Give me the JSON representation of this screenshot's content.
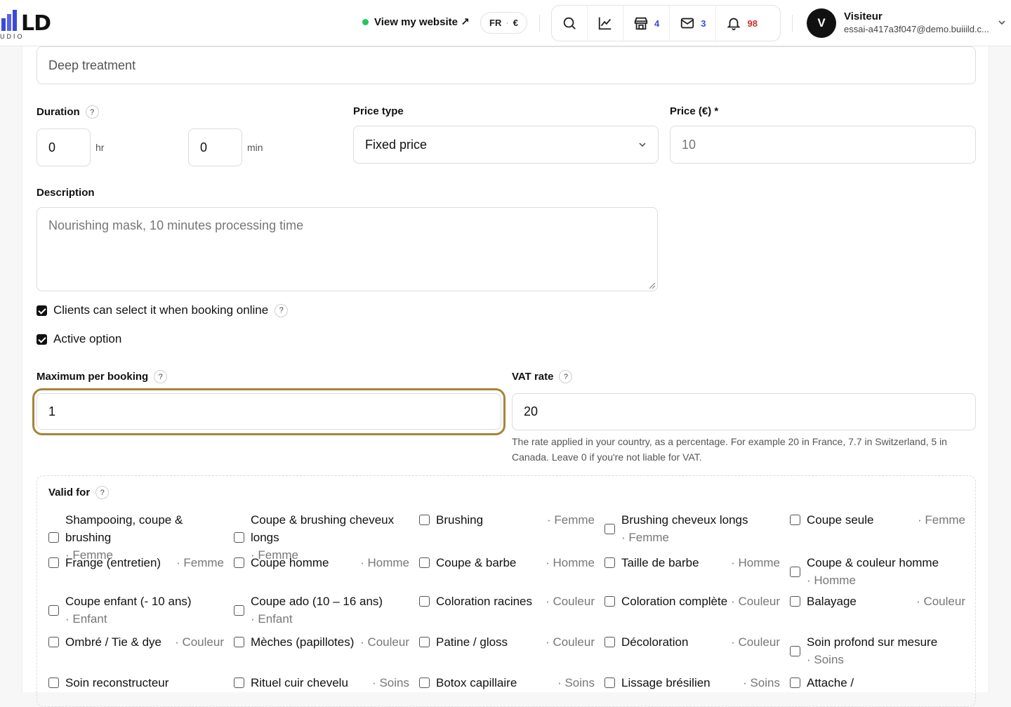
{
  "header": {
    "logo_text": "LD",
    "logo_sub": "UDIO",
    "view_site": "View my website ↗",
    "lang": "FR",
    "currency": "€",
    "counts": {
      "shop": "4",
      "mail": "3",
      "bell": "98"
    },
    "user": {
      "initial": "V",
      "name": "Visiteur",
      "email": "essai-a417a3f047@demo.buiiild.c..."
    },
    "colors": {
      "accent_blue": "#3b4ad6",
      "alert_red": "#d02c2c",
      "online_green": "#22c55e",
      "focus": "#a8833a"
    }
  },
  "form": {
    "name_value": "Deep treatment",
    "duration": {
      "label": "Duration",
      "hours": "0",
      "hours_unit": "hr",
      "minutes": "0",
      "minutes_unit": "min"
    },
    "price_type": {
      "label": "Price type",
      "value": "Fixed price"
    },
    "price": {
      "label": "Price (€) *",
      "placeholder": "10"
    },
    "description": {
      "label": "Description",
      "placeholder": "Nourishing mask, 10 minutes processing time"
    },
    "online_booking": {
      "label": "Clients can select it when booking online",
      "checked": true
    },
    "active": {
      "label": "Active option",
      "checked": true
    },
    "max_per_booking": {
      "label": "Maximum per booking",
      "value": "1"
    },
    "vat": {
      "label": "VAT rate",
      "value": "20",
      "hint": "The rate applied in your country, as a percentage. For example 20 in France, 7.7 in Switzerland, 5 in Canada. Leave 0 if you're not liable for VAT."
    },
    "valid_for": {
      "label": "Valid for",
      "services": [
        {
          "name": "Shampooing, coupe & brushing",
          "cat": "Femme"
        },
        {
          "name": "Coupe & brushing cheveux longs",
          "cat": "Femme"
        },
        {
          "name": "Brushing",
          "cat": "Femme"
        },
        {
          "name": "Brushing cheveux longs",
          "cat": "Femme"
        },
        {
          "name": "Coupe seule",
          "cat": "Femme"
        },
        {
          "name": "Frange (entretien)",
          "cat": "Femme"
        },
        {
          "name": "Coupe homme",
          "cat": "Homme"
        },
        {
          "name": "Coupe & barbe",
          "cat": "Homme"
        },
        {
          "name": "Taille de barbe",
          "cat": "Homme"
        },
        {
          "name": "Coupe & couleur homme",
          "cat": "Homme"
        },
        {
          "name": "Coupe enfant (- 10 ans)",
          "cat": "Enfant"
        },
        {
          "name": "Coupe ado (10 – 16 ans)",
          "cat": "Enfant"
        },
        {
          "name": "Coloration racines",
          "cat": "Couleur"
        },
        {
          "name": "Coloration complète",
          "cat": "Couleur"
        },
        {
          "name": "Balayage",
          "cat": "Couleur"
        },
        {
          "name": "Ombré / Tie & dye",
          "cat": "Couleur"
        },
        {
          "name": "Mèches (papillotes)",
          "cat": "Couleur"
        },
        {
          "name": "Patine / gloss",
          "cat": "Couleur"
        },
        {
          "name": "Décoloration",
          "cat": "Couleur"
        },
        {
          "name": "Soin profond sur mesure",
          "cat": "Soins"
        },
        {
          "name": "Soin reconstructeur",
          "cat": ""
        },
        {
          "name": "Rituel cuir chevelu",
          "cat": "Soins"
        },
        {
          "name": "Botox capillaire",
          "cat": "Soins"
        },
        {
          "name": "Lissage brésilien",
          "cat": "Soins"
        },
        {
          "name": "Attache /",
          "cat": ""
        }
      ]
    }
  }
}
